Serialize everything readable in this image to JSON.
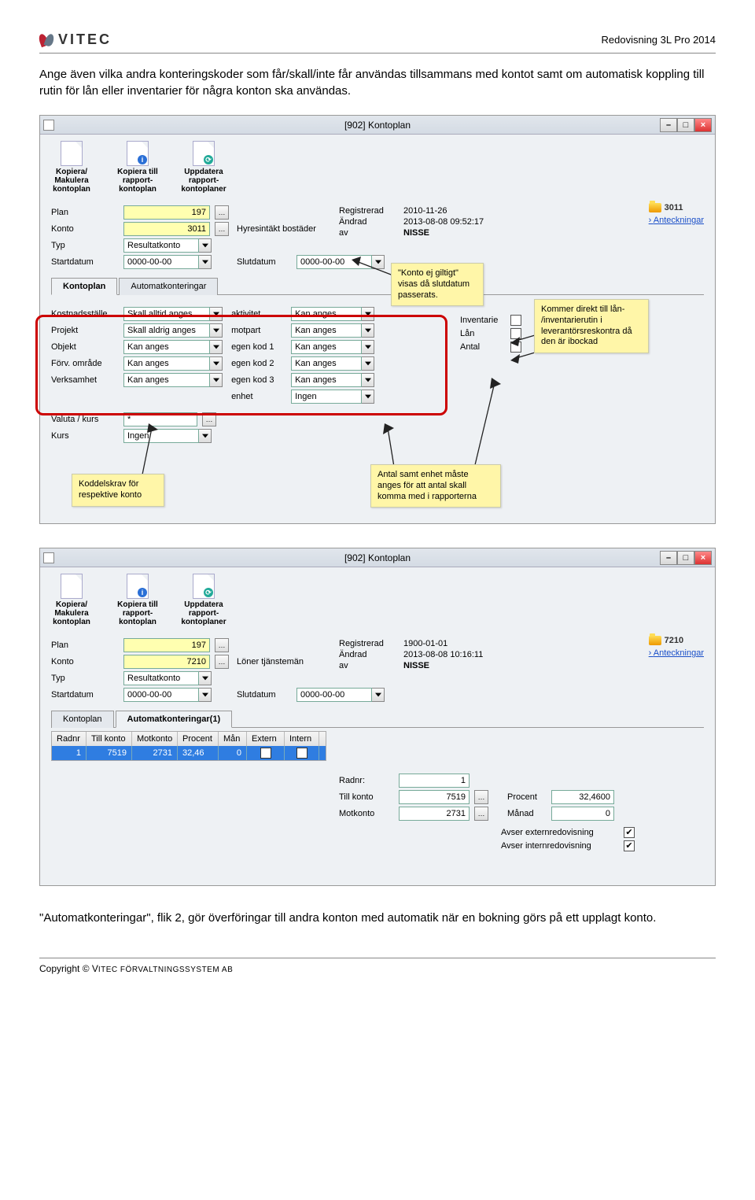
{
  "header": {
    "brand": "VITEC",
    "right": "Redovisning 3L Pro 2014"
  },
  "intro": "Ange även vilka andra konteringskoder som får/skall/inte får användas tillsammans med kontot samt om automatisk koppling till rutin för lån eller inventarier för några konton ska användas.",
  "outro_quote": "Automatkonteringar",
  "outro_rest": ", flik 2, gör överföringar till andra konton med automatik när en bokning görs på ett upplagt konto.",
  "window1": {
    "title": "[902]  Kontoplan",
    "toolbar": [
      {
        "icon": "copy",
        "label": "Kopiera/\nMakulera\nkontoplan"
      },
      {
        "icon": "info",
        "label": "Kopiera till\nrapport-\nkontoplan"
      },
      {
        "icon": "refresh",
        "label": "Uppdatera\nrapport-\nkontoplaner"
      }
    ],
    "folder": "3011",
    "link": "Anteckningar",
    "fields": {
      "plan_lbl": "Plan",
      "plan": "197",
      "konto_lbl": "Konto",
      "konto": "3011",
      "konto_desc": "Hyresintäkt bostäder",
      "typ_lbl": "Typ",
      "typ": "Resultatkonto",
      "start_lbl": "Startdatum",
      "start": "0000-00-00",
      "slut_lbl": "Slutdatum",
      "slut": "0000-00-00"
    },
    "meta": {
      "reg_lbl": "Registrerad",
      "reg": "2010-11-26",
      "andrad_lbl": "Ändrad",
      "andrad": "2013-08-08 09:52:17",
      "av_lbl": "av",
      "av": "NISSE"
    },
    "tabs": {
      "a": "Kontoplan",
      "b": "Automatkonteringar"
    },
    "kod": {
      "kost_lbl": "Kostnadsställe",
      "kost": "Skall alltid anges",
      "proj_lbl": "Projekt",
      "proj": "Skall aldrig anges",
      "obj_lbl": "Objekt",
      "obj": "Kan anges",
      "forv_lbl": "Förv. område",
      "forv": "Kan anges",
      "verk_lbl": "Verksamhet",
      "verk": "Kan anges",
      "akt_lbl": "aktivitet",
      "akt": "Kan anges",
      "mot_lbl": "motpart",
      "mot": "Kan anges",
      "e1_lbl": "egen kod 1",
      "e1": "Kan anges",
      "e2_lbl": "egen kod 2",
      "e2": "Kan anges",
      "e3_lbl": "egen kod 3",
      "e3": "Kan anges",
      "enh_lbl": "enhet",
      "enh": "Ingen",
      "val_lbl": "Valuta / kurs",
      "val": "*",
      "kurs_lbl": "Kurs",
      "kurs": "Ingen",
      "inv_lbl": "Inventarie",
      "lan_lbl": "Lån",
      "ant_lbl": "Antal"
    },
    "notes": {
      "n1": "\"Konto ej giltigt\" visas då slutdatum passerats.",
      "n2": "Kommer direkt till lån- /inventarierutin i leverantörsreskontra då den är ibockad",
      "n3": "Koddelskrav för respektive konto",
      "n4": "Antal samt enhet måste anges för att antal skall komma med i rapporterna"
    }
  },
  "window2": {
    "title": "[902]  Kontoplan",
    "toolbar_labels": {
      "a": "Kopiera/\nMakulera\nkontoplan",
      "b": "Kopiera till\nrapport-\nkontoplan",
      "c": "Uppdatera\nrapport-\nkontoplaner"
    },
    "folder": "7210",
    "link": "Anteckningar",
    "fields": {
      "plan_lbl": "Plan",
      "plan": "197",
      "konto_lbl": "Konto",
      "konto": "7210",
      "konto_desc": "Löner tjänstemän",
      "typ_lbl": "Typ",
      "typ": "Resultatkonto",
      "start_lbl": "Startdatum",
      "start": "0000-00-00",
      "slut_lbl": "Slutdatum",
      "slut": "0000-00-00"
    },
    "meta": {
      "reg_lbl": "Registrerad",
      "reg": "1900-01-01",
      "andrad_lbl": "Ändrad",
      "andrad": "2013-08-08 10:16:11",
      "av_lbl": "av",
      "av": "NISSE"
    },
    "tabs": {
      "a": "Kontoplan",
      "b": "Automatkonteringar(1)"
    },
    "grid": {
      "h1": "Radnr",
      "h2": "Till konto",
      "h3": "Motkonto",
      "h4": "Procent",
      "h5": "Mån",
      "h6": "Extern",
      "h7": "Intern",
      "r1_radnr": "1",
      "r1_till": "7519",
      "r1_mot": "2731",
      "r1_proc": "32,46",
      "r1_man": "0"
    },
    "details": {
      "radnr_lbl": "Radnr:",
      "radnr": "1",
      "till_lbl": "Till konto",
      "till": "7519",
      "mot_lbl": "Motkonto",
      "mot": "2731",
      "proc_lbl": "Procent",
      "proc": "32,4600",
      "man_lbl": "Månad",
      "man": "0",
      "ext_lbl": "Avser externredovisning",
      "int_lbl": "Avser internredovisning"
    }
  },
  "copyright_pre": "Copyright © V",
  "copyright_sc": "ITEC FÖRVALTNINGSSYSTEM AB"
}
